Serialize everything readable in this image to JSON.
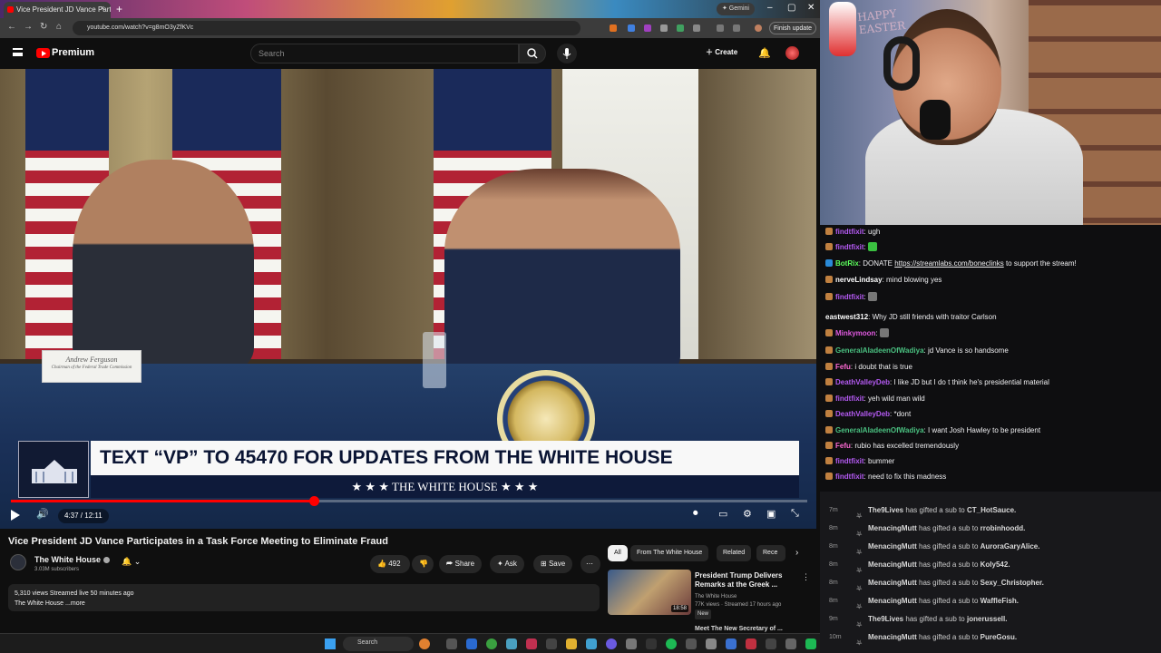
{
  "browser": {
    "tab_title": "Vice President JD Vance Partic",
    "tab_close": "×",
    "new_tab": "+",
    "gemini_label": "✦ Gemini",
    "url": "youtube.com/watch?v=g8mO3yZfKVc",
    "finish_update": "Finish update",
    "win_min": "–",
    "win_max": "▢",
    "win_close": "✕"
  },
  "youtube": {
    "brand": "Premium",
    "search_placeholder": "Search",
    "create_label": "Create"
  },
  "video": {
    "placard_name": "Andrew Ferguson",
    "placard_title": "Chairman of the Federal Trade Commission",
    "lower_third_main": "TEXT “VP” TO 45470 FOR UPDATES FROM THE WHITE HOUSE",
    "lower_third_sub": "★ ★ ★  THE WHITE HOUSE  ★ ★ ★",
    "time": "4:37 / 12:11",
    "progress": 0.38
  },
  "watch": {
    "title": "Vice President JD Vance Participates in a Task Force Meeting to Eliminate Fraud",
    "channel_name": "The White House",
    "subscribers": "3.03M subscribers",
    "likes": "492",
    "share": "Share",
    "ask": "Ask",
    "save": "Save",
    "more": "⋯",
    "desc_line1": "5,310 views  Streamed live 50 minutes ago",
    "desc_line2": "The White House ...more"
  },
  "related": {
    "chips": [
      "All",
      "From The White House",
      "Related",
      "Rece"
    ],
    "items": [
      {
        "title": "President Trump Delivers Remarks at the Greek ...",
        "channel": "The White House",
        "meta": "77K views · Streamed 17 hours ago",
        "badge": "New",
        "duration": "18:58"
      }
    ],
    "next_title": "Meet The New Secretary of ..."
  },
  "taskbar": {
    "search": "Search"
  },
  "chat": {
    "messages": [
      {
        "user": "findtfixit",
        "color": "#b45af2",
        "text": "ugh"
      },
      {
        "user": "findtfixit",
        "color": "#b45af2",
        "text": ""
      },
      {
        "user": "BotRix",
        "color": "#5cff5c",
        "text": "DONATE",
        "link": "https://streamlabs.com/boneclinks",
        "tail": "to support the stream!"
      },
      {
        "user": "nerveLindsay",
        "color": "#ffffff",
        "text": "mind blowing yes"
      },
      {
        "user": "findtfixit",
        "color": "#b45af2",
        "text": ""
      },
      {
        "user": "eastwest312",
        "color": "#ffffff",
        "text": "Why JD still friends with traitor Carlson"
      },
      {
        "user": "Minkymoon",
        "color": "#e05ae0",
        "text": ""
      },
      {
        "user": "GeneralAladeenOfWadiya",
        "color": "#4ac080",
        "text": "jd Vance is so handsome"
      },
      {
        "user": "Fefu",
        "color": "#ff6ad5",
        "text": "i doubt that is true"
      },
      {
        "user": "DeathValleyDeb",
        "color": "#b45af2",
        "text": "I like JD but I do t think he's presidential material"
      },
      {
        "user": "findtfixit",
        "color": "#b45af2",
        "text": "yeh wild man wild"
      },
      {
        "user": "DeathValleyDeb",
        "color": "#b45af2",
        "text": "*dont"
      },
      {
        "user": "GeneralAladeenOfWadiya",
        "color": "#4ac080",
        "text": "I want Josh Hawley to be president"
      },
      {
        "user": "Fefu",
        "color": "#ff6ad5",
        "text": "rubio has excelled tremendously"
      },
      {
        "user": "findtfixit",
        "color": "#b45af2",
        "text": "bummer"
      },
      {
        "user": "findtfixit",
        "color": "#b45af2",
        "text": "need to fix this madness"
      }
    ]
  },
  "subs": [
    {
      "t": "7m",
      "who": "The9Lives",
      "rest": "has gifted a sub to",
      "to": "CT_HotSauce."
    },
    {
      "t": "8m",
      "who": "MenacingMutt",
      "rest": "has gifted a sub to",
      "to": "rrobinhoodd."
    },
    {
      "t": "8m",
      "who": "MenacingMutt",
      "rest": "has gifted a sub to",
      "to": "AuroraGaryAlice."
    },
    {
      "t": "8m",
      "who": "MenacingMutt",
      "rest": "has gifted a sub to",
      "to": "Koly542."
    },
    {
      "t": "8m",
      "who": "MenacingMutt",
      "rest": "has gifted a sub to",
      "to": "Sexy_Christopher."
    },
    {
      "t": "8m",
      "who": "MenacingMutt",
      "rest": "has gifted a sub to",
      "to": "WaffleFish."
    },
    {
      "t": "9m",
      "who": "The9Lives",
      "rest": "has gifted a sub to",
      "to": "jonerussell."
    },
    {
      "t": "10m",
      "who": "MenacingMutt",
      "rest": "has gifted a sub to",
      "to": "PureGosu."
    }
  ],
  "colors": {
    "yt_red": "#ff0000",
    "lower_third_navy": "#0e1a3a",
    "chat_bg": "#0e0e10"
  }
}
